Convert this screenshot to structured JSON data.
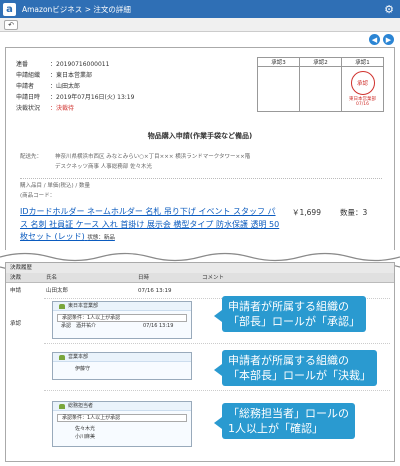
{
  "app": {
    "logo": "a",
    "title": "Amazonビジネス > 注文の詳細",
    "gear": "⚙",
    "back": "↶",
    "nav_prev": "◀",
    "nav_next": "▶"
  },
  "info": [
    {
      "k": "連番",
      "v": "：20190716000011"
    },
    {
      "k": "申請組織",
      "v": "：東日本営業部"
    },
    {
      "k": "申請者",
      "v": "：山田太郎"
    },
    {
      "k": "申請日時",
      "v": "：2019年07月16日(火) 13:19"
    },
    {
      "k": "決裁状況",
      "v": "：決裁待"
    }
  ],
  "stamps": {
    "headers": [
      "承認3",
      "承認2",
      "承認1"
    ],
    "seal_text": "承認",
    "seal_caption_line1": "東日本営業部",
    "seal_caption_line2": "07/16"
  },
  "doc": {
    "title": "物品購入申請(作業手袋など備品)",
    "dest_label": "配送先：",
    "dest_line1": "神奈川県横浜市西区 みなとみらい○×丁目××× 横浜ランドマークタワー××階",
    "dest_line2": "デスクネッツ商事 人事総務部 佐々木光",
    "items_label1": "購入品目 / 単価(税込) / 数量",
    "items_label2": "(商品コード：",
    "item_name": "IDカードホルダー ネームホルダー 名札 吊り下げ イベント スタッフ パス 名刺 社員証 ケース 入れ 首掛け 展示会 横型タイプ 防水保護 透明 50枚セット (レッド)",
    "item_state": "状態：新品",
    "price": "￥1,699",
    "qty": "数量：3"
  },
  "history": {
    "title": "決裁履歴",
    "head": [
      "決裁",
      "氏名",
      "日時",
      "コメント"
    ],
    "apply_label": "申請",
    "apply_name": "山田太郎",
    "apply_time": "07/16 13:19",
    "approve_label": "承認",
    "routes": [
      {
        "title": "東日本営業部",
        "cond": "承認条件：1人以上が承認",
        "people": [
          "承認　酒井祐介"
        ],
        "time": "07/16 13:19"
      },
      {
        "title": "営業本部",
        "cond": "承認条件：1人以上が承認",
        "people": [
          "伊藤守"
        ],
        "time": ""
      },
      {
        "title": "総務担当者",
        "cond": "承認条件：1人以上が承認",
        "people": [
          "佐々木光",
          "小川麻美"
        ],
        "time": ""
      }
    ]
  },
  "callouts": [
    {
      "line1": "申請者が所属する組織の",
      "line2": "「部長」ロールが「承認」"
    },
    {
      "line1": "申請者が所属する組織の",
      "line2": "「本部長」ロールが「決裁」"
    },
    {
      "line1": "「総務担当者」ロールの",
      "line2": "1人以上が「確認」"
    }
  ],
  "colors": {
    "titlebar": "#2f6fb5",
    "callout": "#2a9ad0",
    "seal": "#d0312d",
    "link": "#0b5bbf"
  }
}
